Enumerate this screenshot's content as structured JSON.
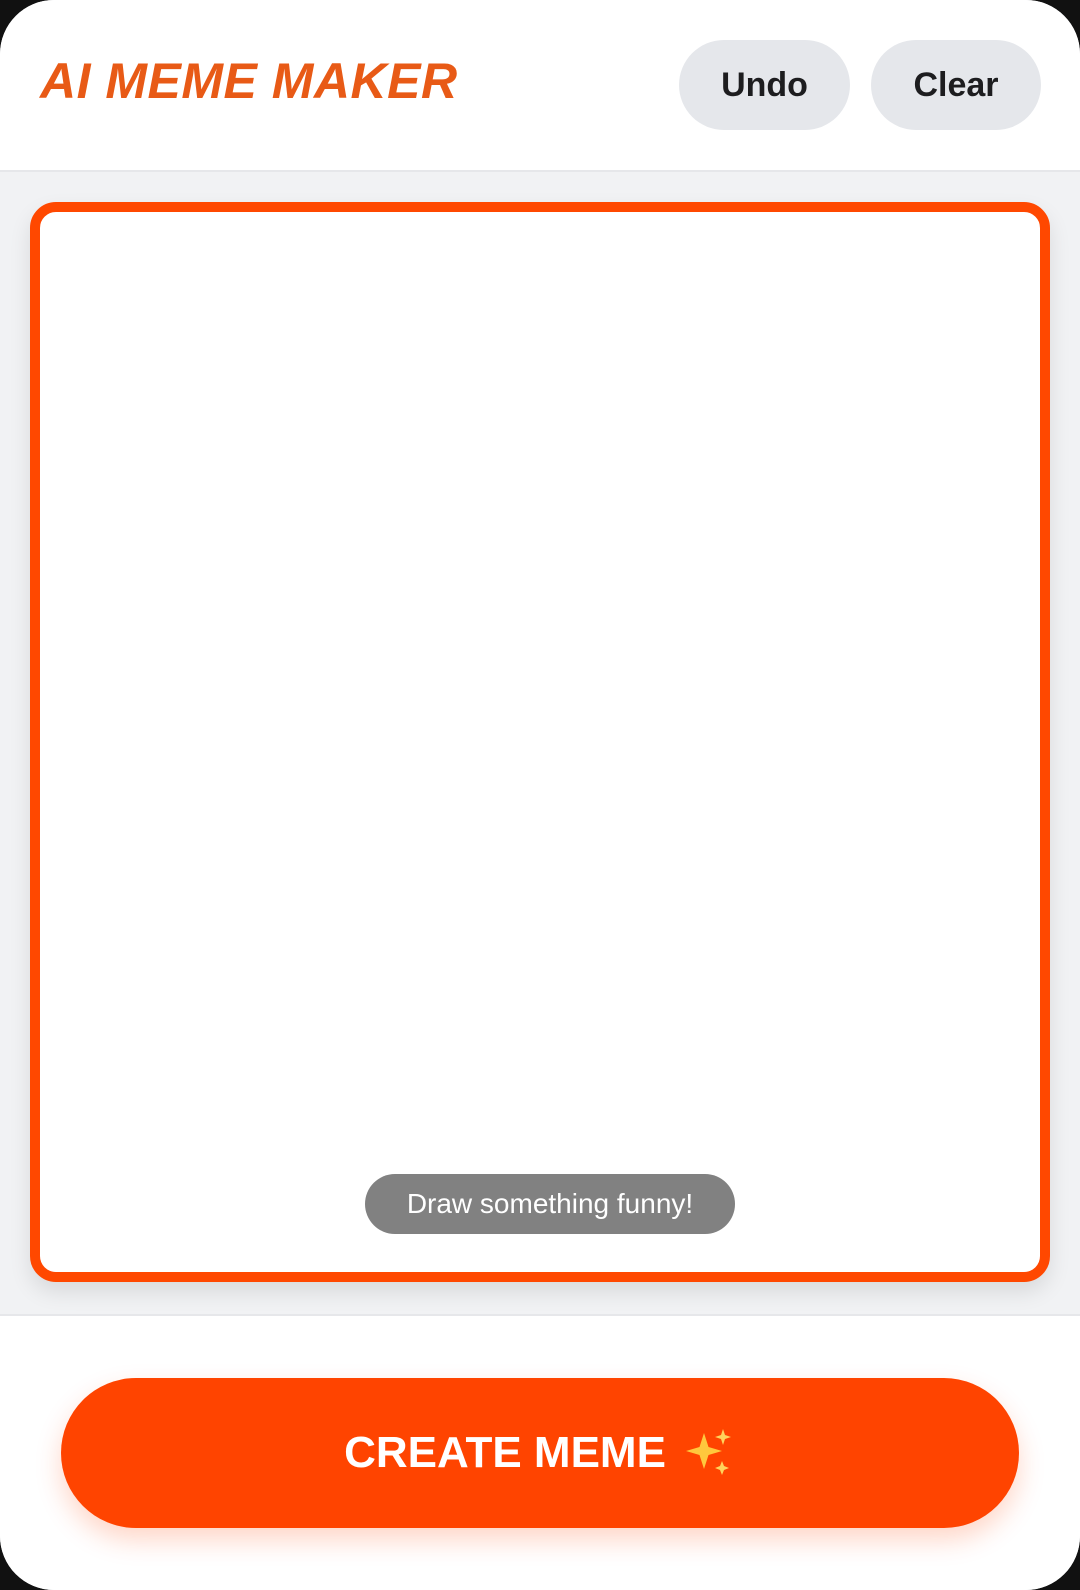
{
  "header": {
    "title": "AI MEME MAKER",
    "undo_label": "Undo",
    "clear_label": "Clear"
  },
  "canvas": {
    "hint": "Draw something funny!"
  },
  "footer": {
    "create_label": "CREATE MEME",
    "create_icon": "sparkles-icon"
  },
  "colors": {
    "accent": "#ff4400",
    "title": "#e85a16",
    "button_bg": "#e5e7eb",
    "hint_bg": "#818181"
  }
}
